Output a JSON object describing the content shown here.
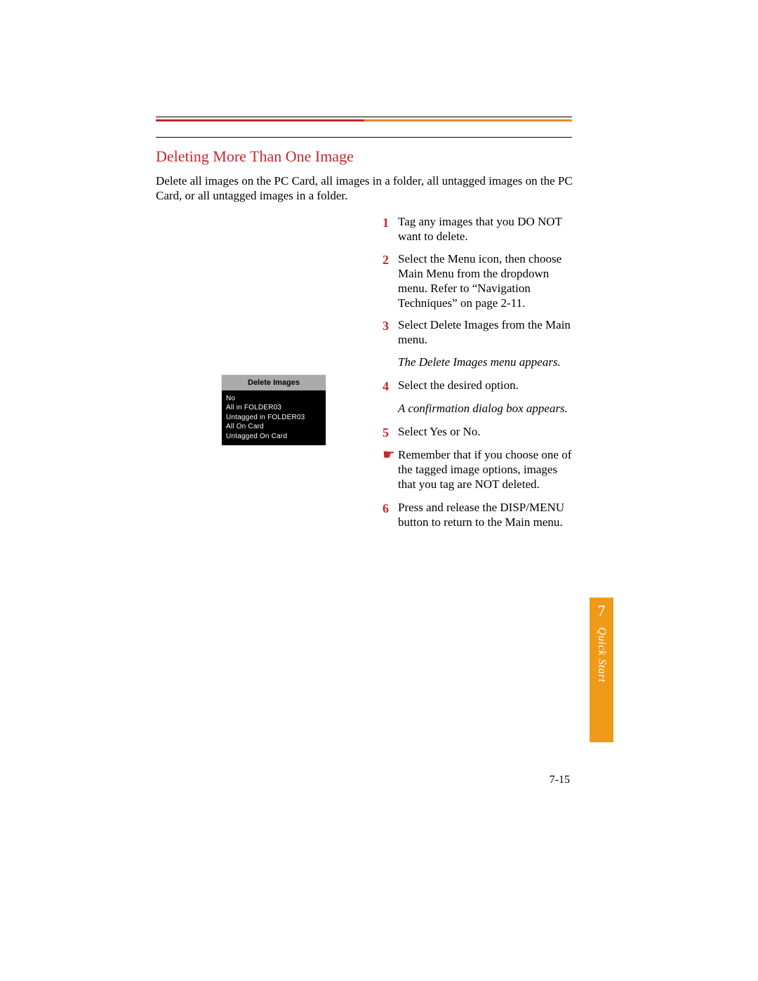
{
  "heading": "Deleting More Than One Image",
  "intro": "Delete all images on the PC Card, all images in a folder, all untagged images on the PC Card, or all untagged images in a folder.",
  "menu": {
    "title": "Delete Images",
    "options": [
      "No",
      "All in FOLDER03",
      "Untagged in FOLDER03",
      "All On Card",
      "Untagged On Card"
    ]
  },
  "steps": {
    "s1_num": "1",
    "s1_a": "Tag any images that you ",
    "s1_b": "DO NOT",
    "s1_c": " want to delete.",
    "s2_num": "2",
    "s2": "Select the Menu icon, then choose Main Menu from the dropdown menu. Refer to “Navigation Techniques” on page 2-11.",
    "s3_num": "3",
    "s3": "Select Delete Images from the Main menu.",
    "r3": "The Delete Images menu appears.",
    "s4_num": "4",
    "s4": "Select the desired option.",
    "r4": "A confirmation dialog box appears.",
    "s5_num": "5",
    "s5": "Select Yes or No.",
    "note_glyph": "☛",
    "note_a": "Remember that if you choose one of the tagged image options, images that you tag are ",
    "note_b": "NOT",
    "note_c": " deleted.",
    "s6_num": "6",
    "s6": "Press and release the DISP/MENU button to return to the Main menu."
  },
  "page_number": "7-15",
  "tab": {
    "chapter": "7",
    "label": "Quick Start"
  }
}
